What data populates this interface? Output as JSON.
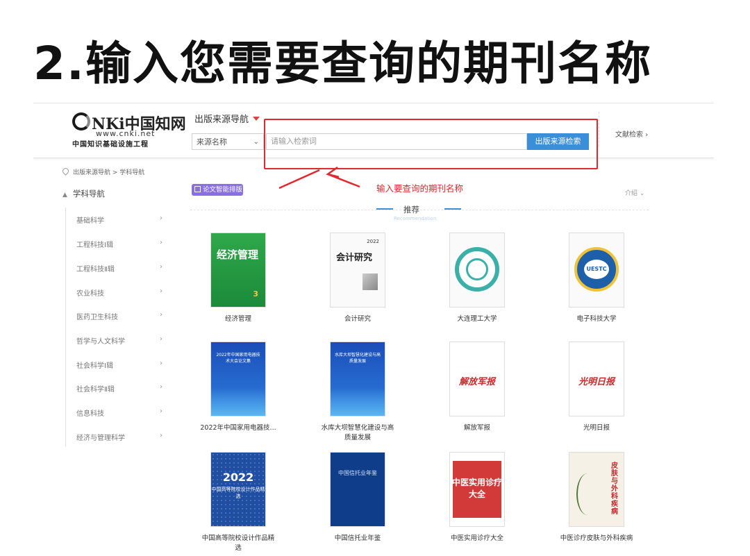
{
  "headline": "2.输入您需要查询的期刊名称",
  "logo": {
    "brand": "NKi中国知网",
    "url": "www.cnki.net",
    "tagline": "中国知识基础设施工程"
  },
  "header": {
    "nav_title": "出版来源导航",
    "select_value": "来源名称",
    "search_placeholder": "请输入检索词",
    "search_button": "出版来源检索",
    "right_link": "文献检索"
  },
  "breadcrumb": [
    "出版来源导航",
    "学科导航"
  ],
  "sidebar": {
    "title": "学科导航",
    "items": [
      "基础科学",
      "工程科技Ⅰ辑",
      "工程科技Ⅱ辑",
      "农业科技",
      "医药卫生科技",
      "哲学与人文科学",
      "社会科学Ⅰ辑",
      "社会科学Ⅱ辑",
      "信息科技",
      "经济与管理科学"
    ]
  },
  "toolbar": {
    "ai_button": "论文智能排版",
    "intro": "介绍"
  },
  "annotation": "输入要查询的期刊名称",
  "recommend": {
    "title": "推荐",
    "subtitle": "Recommendation"
  },
  "cards": [
    {
      "cover_text": "经济管理",
      "cover_extra": "3",
      "caption": "经济管理"
    },
    {
      "cover_text": "会计研究",
      "cover_extra": "2022",
      "caption": "会计研究"
    },
    {
      "cover_text": "",
      "cover_extra": "",
      "caption": "大连理工大学"
    },
    {
      "cover_text": "UESTC",
      "cover_extra": "",
      "caption": "电子科技大学"
    },
    {
      "cover_text": "2022年中国家用电器技术大会论文集",
      "cover_extra": "",
      "caption": "2022年中国家用电器技..."
    },
    {
      "cover_text": "水库大坝智慧化建设与高质量发展",
      "cover_extra": "",
      "caption": "水库大坝智慧化建设与高质量发展"
    },
    {
      "cover_text": "解放军报",
      "cover_extra": "",
      "caption": "解放军报"
    },
    {
      "cover_text": "光明日报",
      "cover_extra": "",
      "caption": "光明日报"
    },
    {
      "cover_text": "中国高等院校设计作品精选",
      "cover_extra": "2022",
      "caption": "中国高等院校设计作品精选"
    },
    {
      "cover_text": "中国信托业年鉴",
      "cover_extra": "",
      "caption": "中国信托业年鉴"
    },
    {
      "cover_text": "中医实用诊疗大全",
      "cover_extra": "",
      "caption": "中医实用诊疗大全"
    },
    {
      "cover_text": "皮肤与外科疾病",
      "cover_extra": "",
      "caption": "中医诊疗皮肤与外科疾病"
    }
  ],
  "colors": {
    "highlight_red": "#e0282e",
    "search_blue": "#3b8fd9",
    "ai_purple": "#8a6fe0"
  }
}
